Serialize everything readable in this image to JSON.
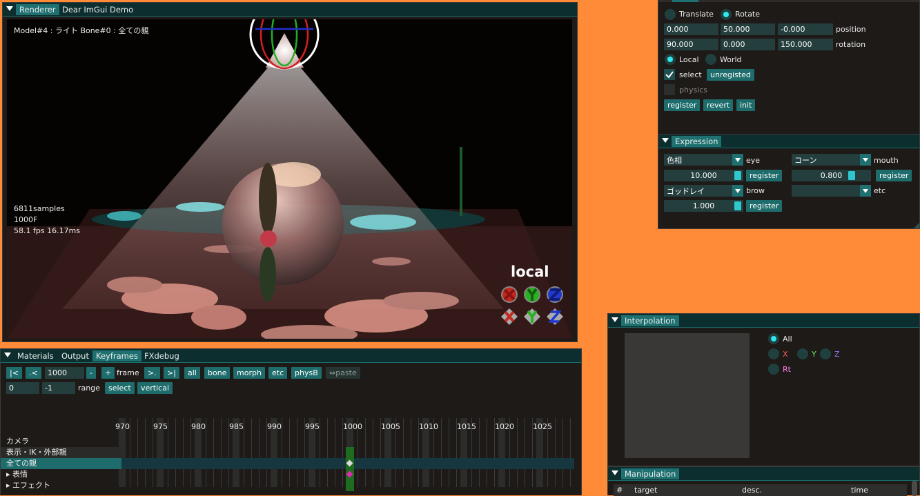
{
  "renderer": {
    "tabs": [
      "Renderer",
      "Dear ImGui Demo"
    ],
    "model_info": "Model#4 : ライト Bone#0 : 全ての親",
    "samples": "6811samples",
    "frame": "1000F",
    "fps": "58.1 fps 16.17ms",
    "gizmo_label": "local"
  },
  "transform": {
    "mode_translate": "Translate",
    "mode_rotate": "Rotate",
    "position": [
      "0.000",
      "50.000",
      "-0.000"
    ],
    "position_label": "position",
    "rotation": [
      "90.000",
      "0.000",
      "150.000"
    ],
    "rotation_label": "rotation",
    "space_local": "Local",
    "space_world": "World",
    "select_label": "select",
    "unregisted": "unregisted",
    "physics_label": "physics",
    "register": "register",
    "revert": "revert",
    "init": "init"
  },
  "expression": {
    "title": "Expression",
    "eye_combo": "色相",
    "eye_label": "eye",
    "eye_value": "10.000",
    "mouth_combo": "コーン",
    "mouth_label": "mouth",
    "mouth_value": "0.800",
    "brow_combo": "ゴッドレイ",
    "brow_label": "brow",
    "brow_value": "1.000",
    "etc_combo": "",
    "etc_label": "etc",
    "register": "register"
  },
  "keyframes": {
    "tabs": [
      "Materials",
      "Output",
      "Keyframes",
      "FXdebug"
    ],
    "btn_first": "|<",
    "btn_prev": ".<",
    "frame_value": "1000",
    "btn_minus": "-",
    "btn_plus": "+",
    "frame_label": "frame",
    "btn_next": ">.",
    "btn_last": ">|",
    "filters": [
      "all",
      "bone",
      "morph",
      "etc",
      "physB"
    ],
    "paste": "⇔paste",
    "range_start": "0",
    "range_end": "-1",
    "range_label": "range",
    "select": "select",
    "vertical": "vertical",
    "ticks": [
      "970",
      "975",
      "980",
      "985",
      "990",
      "995",
      "1000",
      "1005",
      "1010",
      "1015",
      "1020",
      "1025"
    ],
    "rows": [
      "カメラ",
      "表示・IK・外部親",
      "全ての親",
      "▸ 表情",
      "▸ エフェクト"
    ]
  },
  "interpolation": {
    "title": "Interpolation",
    "all": "All",
    "x": "X",
    "y": "Y",
    "z": "Z",
    "rt": "Rt",
    "colors": {
      "x": "#ff5a5a",
      "y": "#6ee86e",
      "z": "#8a7cff",
      "rt": "#ff7cf0"
    }
  },
  "manipulation": {
    "title": "Manipulation",
    "columns": [
      "#",
      "target",
      "desc.",
      "time"
    ]
  },
  "colors": {
    "accent": "#2ee8ee",
    "button": "#1f6c6c",
    "titlebar": "#0c2e2e",
    "background": "#ff8a38"
  }
}
